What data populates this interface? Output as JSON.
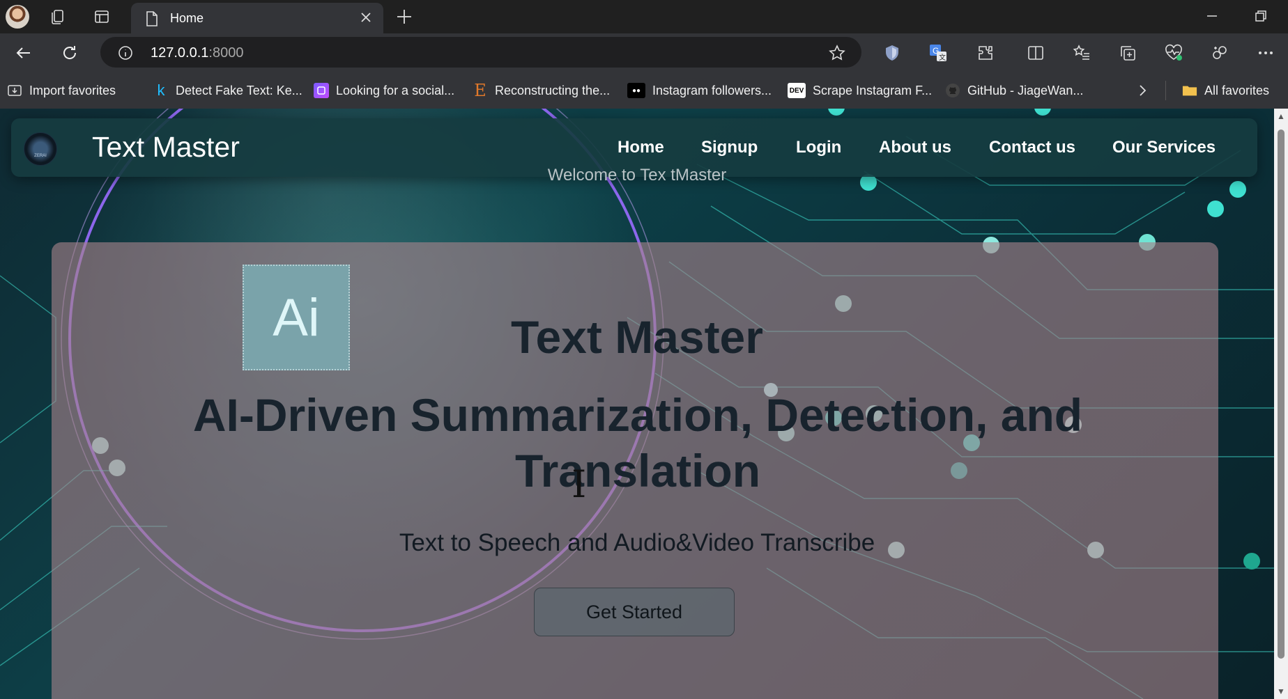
{
  "browser": {
    "tab_title": "Home",
    "url_host": "127.0.0.1",
    "url_port": ":8000",
    "favorites": [
      {
        "label": "Import favorites",
        "icon": "import-icon"
      },
      {
        "label": "Detect Fake Text: Ke...",
        "icon": "kaggle-icon",
        "glyph": "k"
      },
      {
        "label": "Looking for a social...",
        "icon": "app-icon"
      },
      {
        "label": "Reconstructing the...",
        "icon": "letter-e-icon",
        "glyph": "E"
      },
      {
        "label": "Instagram followers...",
        "icon": "medium-icon",
        "glyph": "●●"
      },
      {
        "label": "Scrape Instagram F...",
        "icon": "dev-icon",
        "glyph": "DEV"
      },
      {
        "label": "GitHub - JiageWan...",
        "icon": "github-icon"
      }
    ],
    "all_favorites": "All favorites"
  },
  "site": {
    "logo_text": "ZERAI",
    "brand": "Text Master",
    "nav": [
      "Home",
      "Signup",
      "Login",
      "About us",
      "Contact us",
      "Our Services"
    ],
    "welcome": "Welcome to Tex tMaster",
    "ai_badge": "Ai",
    "hero_title": "Text Master",
    "hero_subtitle": "AI-Driven Summarization, Detection, and Translation",
    "tagline": "Text to Speech and Audio&Video Transcribe",
    "cta": "Get Started"
  },
  "colors": {
    "accent_teal": "#3fe0d0",
    "glow_purple": "#9a6bff"
  }
}
